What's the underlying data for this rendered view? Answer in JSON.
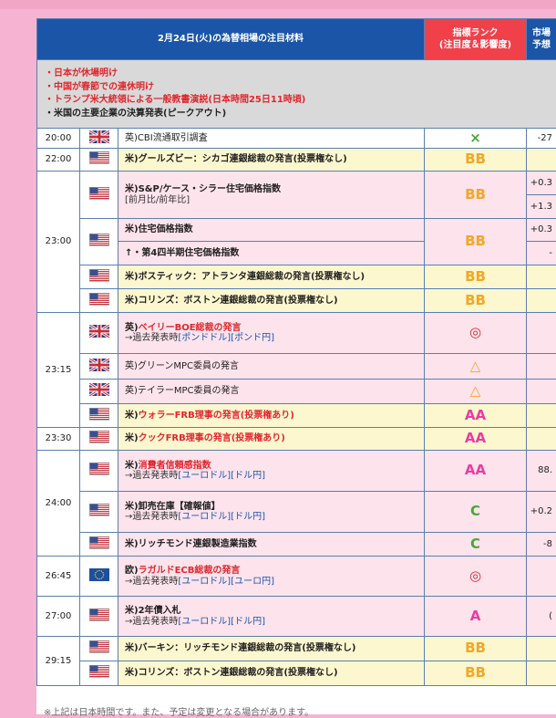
{
  "header": {
    "title": "2月24日(火)の為替相場の注目材料",
    "rank_line1": "指標ランク",
    "rank_line2": "(注目度＆影響度)",
    "market_line1": "市場",
    "market_line2": "予想"
  },
  "notes": [
    {
      "text": "・日本が休場明け",
      "color": "red"
    },
    {
      "text": "・中国が春節での連休明け",
      "color": "red"
    },
    {
      "text": "・トランプ米大統領による一般教書演説(日本時間25日11時頃)",
      "color": "red"
    },
    {
      "text": "・米国の主要企業の決算発表(ピークアウト)",
      "color": "black"
    }
  ],
  "rows": {
    "r1": {
      "time": "20:00",
      "flag": "uk",
      "event": "英)CBI流通取引調査",
      "rank": "×",
      "rank_color": "green",
      "value": "-27"
    },
    "r2": {
      "time": "22:00",
      "flag": "us",
      "event": "米)グールズビー：シカゴ連銀総裁の発言(投票権なし)",
      "rank": "BB",
      "rank_color": "orange"
    },
    "r3": {
      "time": "23:00",
      "flag": "us",
      "event": "米)S&P/ケース・シラー住宅価格指数",
      "sub": "[前月比/前年比]",
      "rank": "BB",
      "rank_color": "orange",
      "value1": "+0.3",
      "value2": "+1.3"
    },
    "r4": {
      "flag": "us",
      "event": "米)住宅価格指数",
      "rank": "BB",
      "rank_color": "orange",
      "value": "+0.3"
    },
    "r5": {
      "event": "↑・第4四半期住宅価格指数",
      "value": "-"
    },
    "r6": {
      "flag": "us",
      "event": "米)ボスティック：アトランタ連銀総裁の発言(投票権なし)",
      "rank": "BB",
      "rank_color": "orange"
    },
    "r7": {
      "flag": "us",
      "event": "米)コリンズ：ボストン連銀総裁の発言(投票権なし)",
      "rank": "BB",
      "rank_color": "orange"
    },
    "r8": {
      "time": "23:15",
      "flag": "uk",
      "event_prefix": "英)",
      "event_red": "ベイリーBOE総裁の発言",
      "link_prefix": "→過去発表時",
      "links": [
        "[ポンドドル]",
        "[ポンド円]"
      ],
      "rank": "◎",
      "rank_color": "red"
    },
    "r9": {
      "flag": "uk",
      "event": "英)グリーンMPC委員の発言",
      "rank": "△",
      "rank_color": "orange"
    },
    "r10": {
      "flag": "uk",
      "event": "英)テイラーMPC委員の発言",
      "rank": "△",
      "rank_color": "orange"
    },
    "r11": {
      "flag": "us",
      "event_prefix": "米)",
      "event_red": "ウォラーFRB理事の発言(投票権あり)",
      "rank": "AA",
      "rank_color": "pink"
    },
    "r12": {
      "time": "23:30",
      "flag": "us",
      "event_prefix": "米)",
      "event_red": "クックFRB理事の発言(投票権あり)",
      "rank": "AA",
      "rank_color": "pink"
    },
    "r13": {
      "time": "24:00",
      "flag": "us",
      "event_prefix": "米)",
      "event_red": "消費者信頼感指数",
      "link_prefix": "→過去発表時",
      "links": [
        "[ユーロドル]",
        "[ドル円]"
      ],
      "rank": "AA",
      "rank_color": "pink",
      "value": "88."
    },
    "r14": {
      "flag": "us",
      "event": "米)卸売在庫【確報値】",
      "link_prefix": "→過去発表時",
      "links": [
        "[ユーロドル]",
        "[ドル円]"
      ],
      "rank": "C",
      "rank_color": "green",
      "value": "+0.2"
    },
    "r15": {
      "flag": "us",
      "event": "米)リッチモンド連銀製造業指数",
      "rank": "C",
      "rank_color": "green",
      "value": "-8"
    },
    "r16": {
      "time": "26:45",
      "flag": "eu",
      "event_prefix": "欧)",
      "event_red": "ラガルドECB総裁の発言",
      "link_prefix": "→過去発表時",
      "links": [
        "[ユーロドル]",
        "[ユーロ円]"
      ],
      "rank": "◎",
      "rank_color": "red"
    },
    "r17": {
      "time": "27:00",
      "flag": "us",
      "event": "米)2年債入札",
      "link_prefix": "→過去発表時",
      "links": [
        "[ユーロドル]",
        "[ドル円]"
      ],
      "rank": "A",
      "rank_color": "pink",
      "value": "("
    },
    "r18": {
      "time": "29:15",
      "flag": "us",
      "event": "米)バーキン：リッチモンド連銀総裁の発言(投票権なし)",
      "rank": "BB",
      "rank_color": "orange"
    },
    "r19": {
      "flag": "us",
      "event": "米)コリンズ：ボストン連銀総裁の発言(投票権なし)",
      "rank": "BB",
      "rank_color": "orange"
    }
  },
  "footer": {
    "text": "※上記は日本時間です。また、予定は変更となる場合があります。"
  },
  "colors": {
    "accent_blue": "#1b55a8",
    "rank_red": "#f0414a",
    "highlight": "#fdf7cf",
    "pink_row": "#fde3ec"
  }
}
